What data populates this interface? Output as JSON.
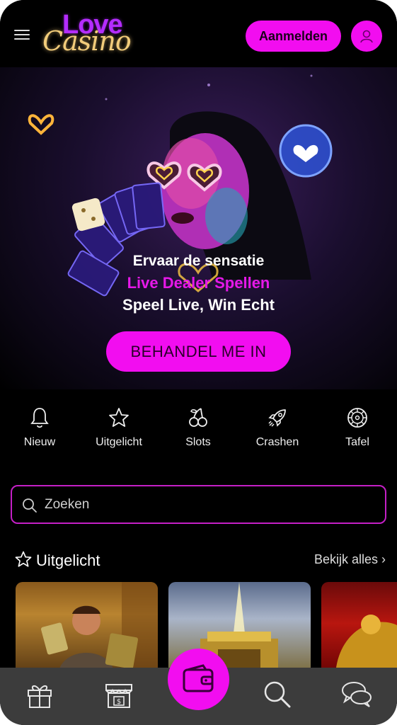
{
  "header": {
    "logo_word_top": "Love",
    "logo_word_bottom": "Casino",
    "signup_label": "Aanmelden"
  },
  "hero": {
    "line1": "Ervaar de sensatie",
    "line2": "Live Dealer Spellen",
    "line3": "Speel Live, Win Echt",
    "cta_label": "BEHANDEL ME IN"
  },
  "categories": [
    {
      "label": "Nieuw",
      "icon": "bell-icon"
    },
    {
      "label": "Uitgelicht",
      "icon": "star-icon"
    },
    {
      "label": "Slots",
      "icon": "cherries-icon"
    },
    {
      "label": "Crashen",
      "icon": "rocket-icon"
    },
    {
      "label": "Tafel",
      "icon": "roulette-icon"
    }
  ],
  "search": {
    "placeholder": "Zoeken"
  },
  "featured": {
    "title": "Uitgelicht",
    "see_all": "Bekijk alles ›"
  },
  "bottom_nav": [
    "gift-icon",
    "shop-icon",
    "wallet-icon",
    "search-icon",
    "chat-icon"
  ],
  "colors": {
    "accent": "#f20df0",
    "background": "#000000",
    "nav_bg": "#3c3c3c"
  }
}
